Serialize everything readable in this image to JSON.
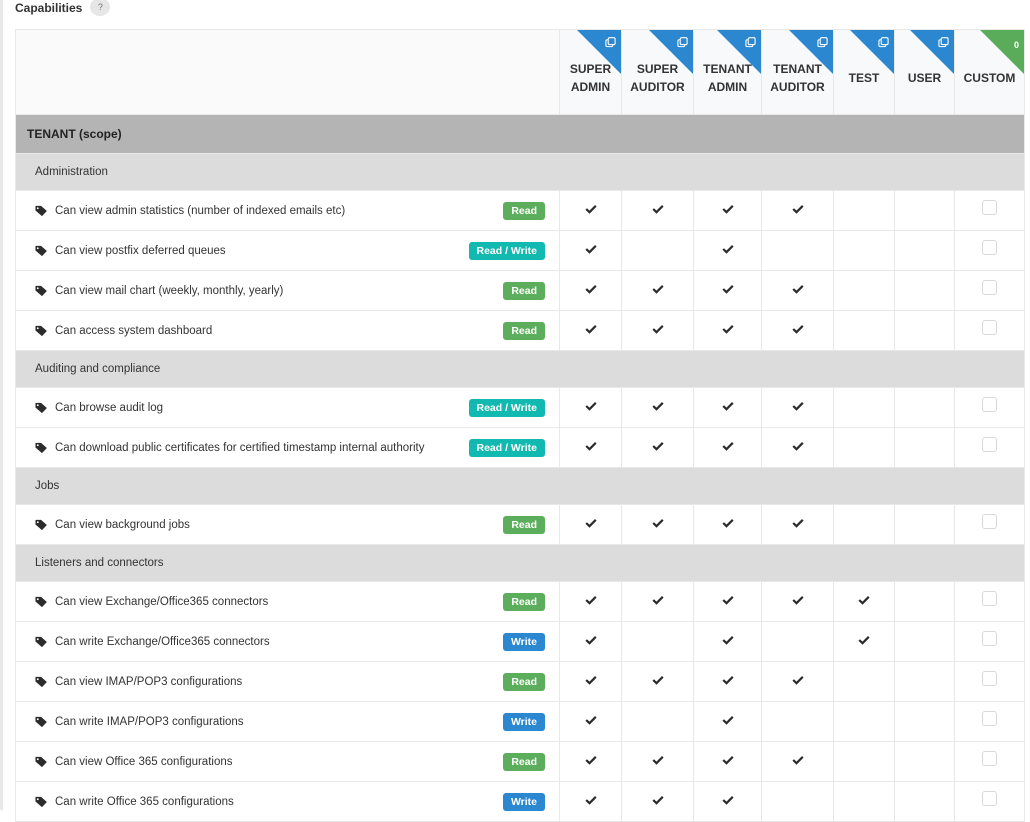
{
  "title": "Capabilities",
  "help_label": "?",
  "columns": [
    {
      "line1": "SUPER",
      "line2": "ADMIN",
      "corner": "copy",
      "color": "#2a87d0"
    },
    {
      "line1": "SUPER",
      "line2": "AUDITOR",
      "corner": "copy",
      "color": "#2a87d0"
    },
    {
      "line1": "TENANT",
      "line2": "ADMIN",
      "corner": "copy",
      "color": "#2a87d0"
    },
    {
      "line1": "TENANT",
      "line2": "AUDITOR",
      "corner": "copy",
      "color": "#2a87d0"
    },
    {
      "line1": "TEST",
      "line2": "",
      "corner": "copy",
      "color": "#2a87d0"
    },
    {
      "line1": "USER",
      "line2": "",
      "corner": "copy",
      "color": "#2a87d0"
    },
    {
      "line1": "CUSTOM",
      "line2": "",
      "corner": "count",
      "count": "0",
      "color": "#5aab5a"
    }
  ],
  "scope": "TENANT (scope)",
  "groups": [
    {
      "name": "Administration",
      "items": [
        {
          "label": "Can view admin statistics (number of indexed emails etc)",
          "badge": "Read",
          "type": "read",
          "checks": [
            true,
            true,
            true,
            true,
            false,
            false
          ],
          "custom": false
        },
        {
          "label": "Can view postfix deferred queues",
          "badge": "Read / Write",
          "type": "rw",
          "checks": [
            true,
            false,
            true,
            false,
            false,
            false
          ],
          "custom": false
        },
        {
          "label": "Can view mail chart (weekly, monthly, yearly)",
          "badge": "Read",
          "type": "read",
          "checks": [
            true,
            true,
            true,
            true,
            false,
            false
          ],
          "custom": false
        },
        {
          "label": "Can access system dashboard",
          "badge": "Read",
          "type": "read",
          "checks": [
            true,
            true,
            true,
            true,
            false,
            false
          ],
          "custom": false
        }
      ]
    },
    {
      "name": "Auditing and compliance",
      "items": [
        {
          "label": "Can browse audit log",
          "badge": "Read / Write",
          "type": "rw",
          "checks": [
            true,
            true,
            true,
            true,
            false,
            false
          ],
          "custom": false
        },
        {
          "label": "Can download public certificates for certified timestamp internal authority",
          "badge": "Read / Write",
          "type": "rw",
          "checks": [
            true,
            true,
            true,
            true,
            false,
            false
          ],
          "custom": false
        }
      ]
    },
    {
      "name": "Jobs",
      "items": [
        {
          "label": "Can view background jobs",
          "badge": "Read",
          "type": "read",
          "checks": [
            true,
            true,
            true,
            true,
            false,
            false
          ],
          "custom": false
        }
      ]
    },
    {
      "name": "Listeners and connectors",
      "items": [
        {
          "label": "Can view Exchange/Office365 connectors",
          "badge": "Read",
          "type": "read",
          "checks": [
            true,
            true,
            true,
            true,
            true,
            false
          ],
          "custom": false
        },
        {
          "label": "Can write Exchange/Office365 connectors",
          "badge": "Write",
          "type": "write",
          "checks": [
            true,
            false,
            true,
            false,
            true,
            false
          ],
          "custom": false
        },
        {
          "label": "Can view IMAP/POP3 configurations",
          "badge": "Read",
          "type": "read",
          "checks": [
            true,
            true,
            true,
            true,
            false,
            false
          ],
          "custom": false
        },
        {
          "label": "Can write IMAP/POP3 configurations",
          "badge": "Write",
          "type": "write",
          "checks": [
            true,
            false,
            true,
            false,
            false,
            false
          ],
          "custom": false
        },
        {
          "label": "Can view Office 365 configurations",
          "badge": "Read",
          "type": "read",
          "checks": [
            true,
            true,
            true,
            true,
            false,
            false
          ],
          "custom": false
        },
        {
          "label": "Can write Office 365 configurations",
          "badge": "Write",
          "type": "write",
          "checks": [
            true,
            true,
            true,
            false,
            false,
            false
          ],
          "custom": false
        }
      ]
    }
  ]
}
